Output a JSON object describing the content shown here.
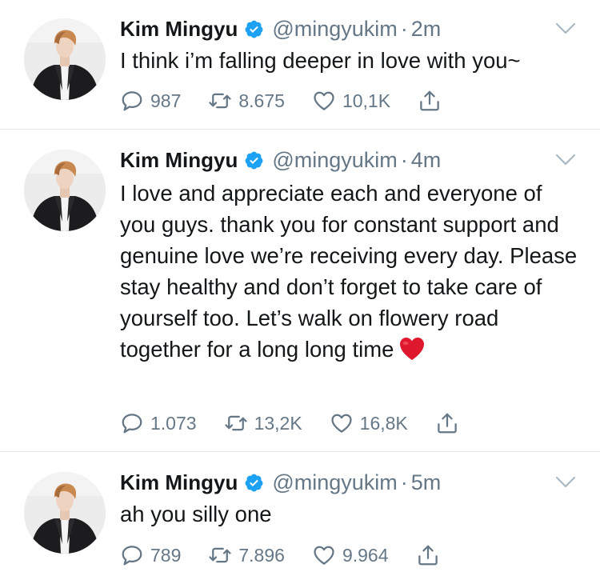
{
  "tweets": [
    {
      "author": "Kim Mingyu",
      "handle": "@mingyukim",
      "separator": "·",
      "time": "2m",
      "text": "I think i’m falling deeper in love with you~",
      "emoji": "",
      "replies": "987",
      "retweets": "8.675",
      "likes": "10,1K"
    },
    {
      "author": "Kim Mingyu",
      "handle": "@mingyukim",
      "separator": "·",
      "time": "4m",
      "text": "I love and appreciate each and everyone of you guys. thank you for constant support and genuine love we’re receiving every day. Please stay healthy and don’t forget to take care of yourself too. Let’s walk on flowery road together for a long long time",
      "emoji": "red-heart-emoji",
      "replies": "1.073",
      "retweets": "13,2K",
      "likes": "16,8K"
    },
    {
      "author": "Kim Mingyu",
      "handle": "@mingyukim",
      "separator": "·",
      "time": "5m",
      "text": "ah you silly one",
      "emoji": "",
      "replies": "789",
      "retweets": "7.896",
      "likes": "9.964"
    }
  ],
  "colors": {
    "verified": "#1da1f2",
    "secondary_text": "#657786",
    "divider": "#e1e8ed",
    "heart_emoji": "#e0182d"
  },
  "icons": [
    "verified-badge-icon",
    "chevron-down-icon",
    "reply-icon",
    "retweet-icon",
    "like-icon",
    "share-icon"
  ]
}
